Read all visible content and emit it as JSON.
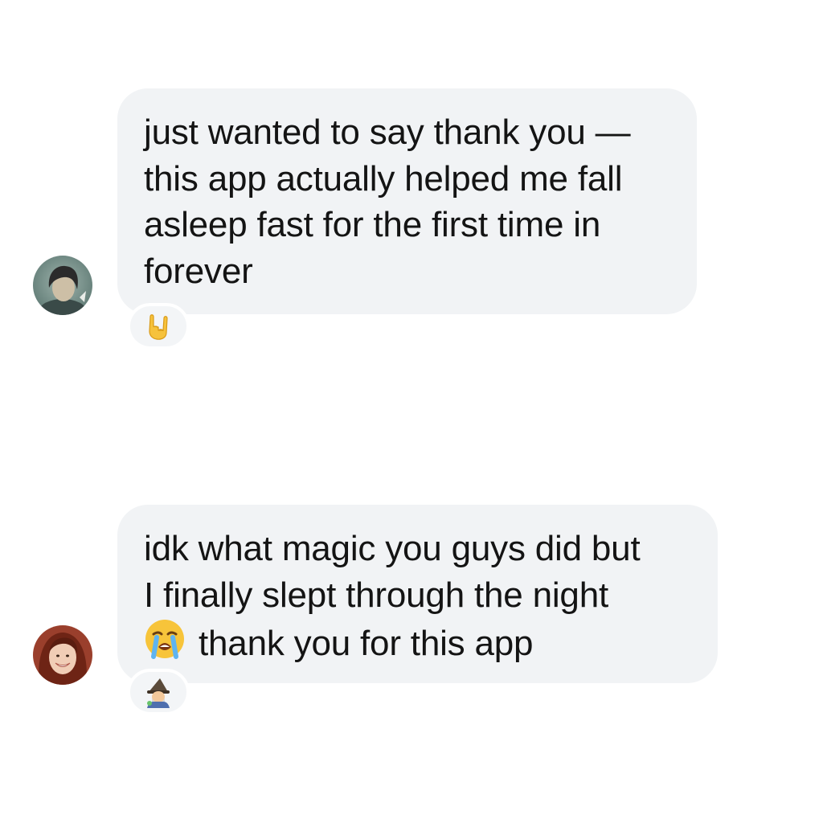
{
  "thread": {
    "messages": [
      {
        "avatar_icon": "user-avatar-short-dark-hair",
        "text": "just wanted to say thank you —\nthis app actually helped me fall\nasleep fast for the first time in\nforever",
        "reaction_icon": "sign-of-the-horns-emoji"
      },
      {
        "avatar_icon": "user-avatar-smiling-woman-red-hair",
        "text_line1": "idk what magic you guys did but\nI finally slept through the night\n",
        "inline_emoji_icon": "loudly-crying-face-emoji",
        "text_line2": "thank you for this app",
        "reaction_icon": "mage-emoji"
      }
    ]
  },
  "colors": {
    "background": "#ffffff",
    "bubble": "#f1f3f5",
    "text": "#141414",
    "reaction_bg": "#f3f5f7"
  }
}
